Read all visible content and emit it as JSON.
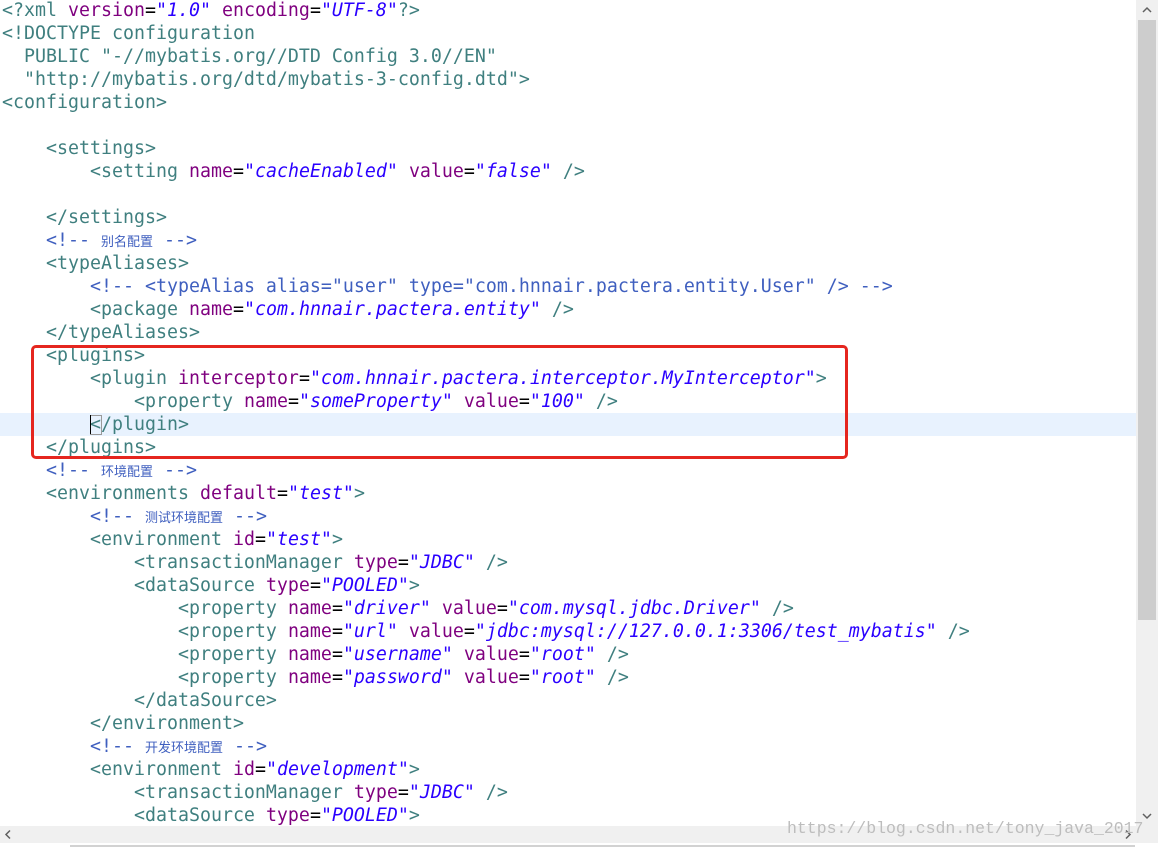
{
  "colors": {
    "tag": "#3F7F7F",
    "attr": "#7F007F",
    "value": "#2A00FF",
    "comment": "#3F5FBF",
    "text": "#000000",
    "current_line": "#E8F2FE",
    "annotation": "#E5261F",
    "scrollbar_track": "#F0F0F0",
    "scrollbar_thumb": "#CDCDCD",
    "watermark": "#BDBDBD"
  },
  "icons": {
    "scroll_up": "chevron-up-icon",
    "scroll_down": "chevron-down-icon",
    "scroll_left": "chevron-left-icon",
    "scroll_right": "chevron-right-icon"
  },
  "scrollbars": {
    "vertical": {
      "position": 0,
      "visible_fraction": 0.763
    }
  },
  "editor": {
    "caret": {
      "line": 19,
      "column": 9
    },
    "lines": [
      [
        {
          "tag": "<?xml"
        },
        {
          "text": " "
        },
        {
          "attr": "version"
        },
        {
          "text": "="
        },
        {
          "value": "\"1.0\""
        },
        {
          "text": " "
        },
        {
          "attr": "encoding"
        },
        {
          "text": "="
        },
        {
          "value": "\"UTF-8\""
        },
        {
          "tag": "?>"
        }
      ],
      [
        {
          "tag": "<!DOCTYPE"
        },
        {
          "text": " "
        },
        {
          "tag": "configuration"
        }
      ],
      [
        {
          "text": "  "
        },
        {
          "tag": "PUBLIC"
        },
        {
          "text": " "
        },
        {
          "tag": "\"-//mybatis.org//DTD Config 3.0//EN\""
        }
      ],
      [
        {
          "text": "  "
        },
        {
          "tag": "\"http://mybatis.org/dtd/mybatis-3-config.dtd\">"
        }
      ],
      [
        {
          "tag": "<configuration>"
        }
      ],
      [],
      [
        {
          "text": "    "
        },
        {
          "tag": "<settings>"
        }
      ],
      [
        {
          "text": "        "
        },
        {
          "tag": "<setting"
        },
        {
          "text": " "
        },
        {
          "attr": "name"
        },
        {
          "text": "="
        },
        {
          "value": "\"cacheEnabled\""
        },
        {
          "text": " "
        },
        {
          "attr": "value"
        },
        {
          "text": "="
        },
        {
          "value": "\"false\""
        },
        {
          "text": " "
        },
        {
          "tag": "/>"
        }
      ],
      [],
      [
        {
          "text": "    "
        },
        {
          "tag": "</settings>"
        }
      ],
      [
        {
          "text": "    "
        },
        {
          "comment": "<!-- "
        },
        {
          "cjk": "别名配置"
        },
        {
          "comment": " -->"
        }
      ],
      [
        {
          "text": "    "
        },
        {
          "tag": "<typeAliases>"
        }
      ],
      [
        {
          "text": "        "
        },
        {
          "comment": "<!-- <typeAlias alias=\"user\" type=\"com.hnnair.pactera.entity.User\" /> -->"
        }
      ],
      [
        {
          "text": "        "
        },
        {
          "tag": "<package"
        },
        {
          "text": " "
        },
        {
          "attr": "name"
        },
        {
          "text": "="
        },
        {
          "value": "\"com.hnnair.pactera.entity\""
        },
        {
          "text": " "
        },
        {
          "tag": "/>"
        }
      ],
      [
        {
          "text": "    "
        },
        {
          "tag": "</typeAliases>"
        }
      ],
      [
        {
          "text": "    "
        },
        {
          "tag": "<plugins>"
        }
      ],
      [
        {
          "text": "        "
        },
        {
          "tag": "<plugin"
        },
        {
          "text": " "
        },
        {
          "attr": "interceptor"
        },
        {
          "text": "="
        },
        {
          "value": "\"com.hnnair.pactera.interceptor.MyInterceptor\""
        },
        {
          "tag": ">"
        }
      ],
      [
        {
          "text": "            "
        },
        {
          "tag": "<property"
        },
        {
          "text": " "
        },
        {
          "attr": "name"
        },
        {
          "text": "="
        },
        {
          "value": "\"someProperty\""
        },
        {
          "text": " "
        },
        {
          "attr": "value"
        },
        {
          "text": "="
        },
        {
          "value": "\"100\""
        },
        {
          "text": " "
        },
        {
          "tag": "/>"
        }
      ],
      [
        {
          "text": "        "
        },
        {
          "tag": "</plugin>"
        }
      ],
      [
        {
          "text": "    "
        },
        {
          "tag": "</plugins>"
        }
      ],
      [
        {
          "text": "    "
        },
        {
          "comment": "<!-- "
        },
        {
          "cjk": "环境配置"
        },
        {
          "comment": " -->"
        }
      ],
      [
        {
          "text": "    "
        },
        {
          "tag": "<environments"
        },
        {
          "text": " "
        },
        {
          "attr": "default"
        },
        {
          "text": "="
        },
        {
          "value": "\"test\""
        },
        {
          "tag": ">"
        }
      ],
      [
        {
          "text": "        "
        },
        {
          "comment": "<!-- "
        },
        {
          "cjk": "测试环境配置"
        },
        {
          "comment": " -->"
        }
      ],
      [
        {
          "text": "        "
        },
        {
          "tag": "<environment"
        },
        {
          "text": " "
        },
        {
          "attr": "id"
        },
        {
          "text": "="
        },
        {
          "value": "\"test\""
        },
        {
          "tag": ">"
        }
      ],
      [
        {
          "text": "            "
        },
        {
          "tag": "<transactionManager"
        },
        {
          "text": " "
        },
        {
          "attr": "type"
        },
        {
          "text": "="
        },
        {
          "value": "\"JDBC\""
        },
        {
          "text": " "
        },
        {
          "tag": "/>"
        }
      ],
      [
        {
          "text": "            "
        },
        {
          "tag": "<dataSource"
        },
        {
          "text": " "
        },
        {
          "attr": "type"
        },
        {
          "text": "="
        },
        {
          "value": "\"POOLED\""
        },
        {
          "tag": ">"
        }
      ],
      [
        {
          "text": "                "
        },
        {
          "tag": "<property"
        },
        {
          "text": " "
        },
        {
          "attr": "name"
        },
        {
          "text": "="
        },
        {
          "value": "\"driver\""
        },
        {
          "text": " "
        },
        {
          "attr": "value"
        },
        {
          "text": "="
        },
        {
          "value": "\"com.mysql.jdbc.Driver\""
        },
        {
          "text": " "
        },
        {
          "tag": "/>"
        }
      ],
      [
        {
          "text": "                "
        },
        {
          "tag": "<property"
        },
        {
          "text": " "
        },
        {
          "attr": "name"
        },
        {
          "text": "="
        },
        {
          "value": "\"url\""
        },
        {
          "text": " "
        },
        {
          "attr": "value"
        },
        {
          "text": "="
        },
        {
          "value": "\"jdbc:mysql://127.0.0.1:3306/test_mybatis\""
        },
        {
          "text": " "
        },
        {
          "tag": "/>"
        }
      ],
      [
        {
          "text": "                "
        },
        {
          "tag": "<property"
        },
        {
          "text": " "
        },
        {
          "attr": "name"
        },
        {
          "text": "="
        },
        {
          "value": "\"username\""
        },
        {
          "text": " "
        },
        {
          "attr": "value"
        },
        {
          "text": "="
        },
        {
          "value": "\"root\""
        },
        {
          "text": " "
        },
        {
          "tag": "/>"
        }
      ],
      [
        {
          "text": "                "
        },
        {
          "tag": "<property"
        },
        {
          "text": " "
        },
        {
          "attr": "name"
        },
        {
          "text": "="
        },
        {
          "value": "\"password\""
        },
        {
          "text": " "
        },
        {
          "attr": "value"
        },
        {
          "text": "="
        },
        {
          "value": "\"root\""
        },
        {
          "text": " "
        },
        {
          "tag": "/>"
        }
      ],
      [
        {
          "text": "            "
        },
        {
          "tag": "</dataSource>"
        }
      ],
      [
        {
          "text": "        "
        },
        {
          "tag": "</environment>"
        }
      ],
      [
        {
          "text": "        "
        },
        {
          "comment": "<!-- "
        },
        {
          "cjk": "开发环境配置"
        },
        {
          "comment": " -->"
        }
      ],
      [
        {
          "text": "        "
        },
        {
          "tag": "<environment"
        },
        {
          "text": " "
        },
        {
          "attr": "id"
        },
        {
          "text": "="
        },
        {
          "value": "\"development\""
        },
        {
          "tag": ">"
        }
      ],
      [
        {
          "text": "            "
        },
        {
          "tag": "<transactionManager"
        },
        {
          "text": " "
        },
        {
          "attr": "type"
        },
        {
          "text": "="
        },
        {
          "value": "\"JDBC\""
        },
        {
          "text": " "
        },
        {
          "tag": "/>"
        }
      ],
      [
        {
          "text": "            "
        },
        {
          "tag": "<dataSource"
        },
        {
          "text": " "
        },
        {
          "attr": "type"
        },
        {
          "text": "="
        },
        {
          "value": "\"POOLED\""
        },
        {
          "tag": ">"
        }
      ]
    ]
  },
  "watermark": "https://blog.csdn.net/tony_java_2017"
}
